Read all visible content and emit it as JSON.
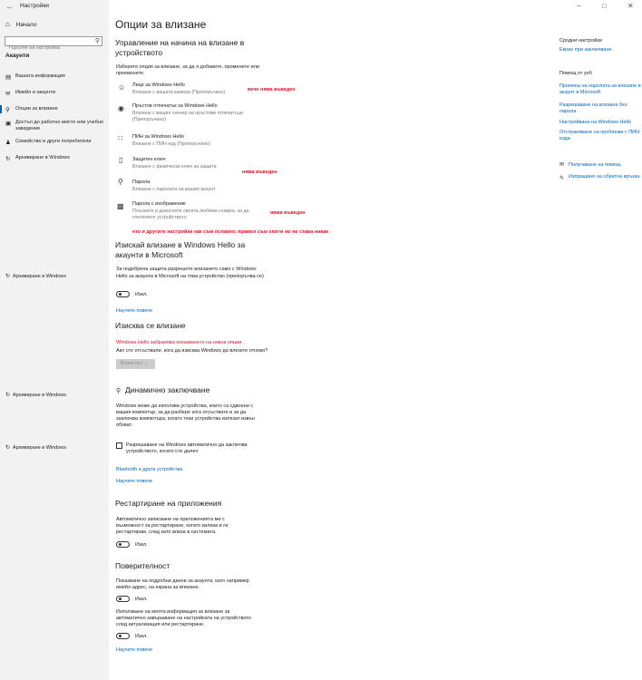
{
  "window": {
    "title": "Настройки",
    "back_icon": "back-arrow-icon",
    "minimize": "–",
    "maximize": "□",
    "close": "✕"
  },
  "sidebar": {
    "home": "Начало",
    "search_placeholder": "Търсене на настройка",
    "section": "Акаунти",
    "items": [
      {
        "label": "Вашата информация",
        "icon": "person-card-icon"
      },
      {
        "label": "Имейл и акаунти",
        "icon": "mail-icon"
      },
      {
        "label": "Опции за влизане",
        "icon": "key-icon"
      },
      {
        "label": "Достъп до работно място или учебно заведение",
        "icon": "briefcase-icon"
      },
      {
        "label": "Семейство и други потребители",
        "icon": "people-icon"
      },
      {
        "label": "Архивиране в Windows",
        "icon": "sync-icon"
      }
    ],
    "archive_repeats": [
      "Архивиране в Windows",
      "Архивиране в Windows",
      "Архивиране в Windows"
    ]
  },
  "main": {
    "title": "Опции за влизане",
    "manage_heading": "Управление на начина на влизане в устройството",
    "choose_text": "Изберете опция за влизане, за да я добавите, промените или премахнете.",
    "options": [
      {
        "title": "Лице за Windows Hello",
        "desc": "Влизане с вашата камера (Препоръчано)",
        "icon": "face-icon",
        "note": "вече няма въведен"
      },
      {
        "title": "Пръстов отпечатък за Windows Hello",
        "desc": "Влизане с вашия скенер на пръстови отпечатъци (Препоръчано)",
        "icon": "fingerprint-icon",
        "note": ""
      },
      {
        "title": "ПИН за Windows Hello",
        "desc": "Влизане с ПИН код (Препоръчано)",
        "icon": "pin-keypad-icon",
        "note": ""
      },
      {
        "title": "Защитен ключ",
        "desc": "Влизане с физически ключ за защита",
        "icon": "usb-key-icon",
        "note": "няма въведен"
      },
      {
        "title": "Парола",
        "desc": "Влизане с паролата на вашия акаунт",
        "icon": "password-key-icon",
        "note": ""
      },
      {
        "title": "Парола с изображение",
        "desc": "Плъзнете и докоснете своята любима снимка, за да отключите устройството",
        "icon": "picture-icon",
        "note": "няма въведен"
      }
    ],
    "red_comment": "ето и другите настройки как съм оставил, правил съм опити но не става никак",
    "hello_heading": "Изискай влизане в Windows Hello за акаунти в Microsoft",
    "hello_desc": "За подобрена защита разрешете влизането само с Windows Hello за акаунти в Microsoft на това устройство (препоръчва се)",
    "toggle_off": "Изкл.",
    "learn_more": "Научете повече",
    "require_heading": "Изисква се влизане",
    "hello_blocked": "Windows Hello забранява показването на някои опции.",
    "away_question": "Ако сте отсъствали, кога да изисква Windows да влезете отново?",
    "never_button": "Всеки път",
    "dynamic_heading": "Динамично заключване",
    "dynamic_desc": "Windows може да използва устройства, които са сдвоени с вашия компютър, за да разбере кога отсъствате и за да заключва компютъра, когато тези устройства излязат извън обхват.",
    "dynamic_checkbox": "Разрешаване на Windows автоматично да заключва устройството, когато сте далеч",
    "bluetooth_link": "Bluetooth и други устройства",
    "restart_heading": "Рестартиране на приложения",
    "restart_desc": "Автоматично записване на приложенията ми с възможност за рестартиране, когато излиза и ги рестартирам, след като влиза в системата.",
    "privacy_heading": "Поверителност",
    "privacy_desc1": "Показване на подробни данни за акаунта, като например имейл адрес, на екрана за влизане.",
    "privacy_desc2": "Използване на моята информация за влизане за автоматично завършване на настройката на устройството след актуализация или рестартиране."
  },
  "right": {
    "related_heading": "Сродни настройки",
    "related_link": "Екран при заключване",
    "help_heading": "Помощ от уеб",
    "help_links": [
      "Промяна на паролата за влизане в акаунт в Microsoft",
      "Разрешаване на влизане без парола",
      "Настройване на Windows Hello",
      "Отстраняване на проблеми с ПИН кода"
    ],
    "get_help": "Получаване на помощ",
    "feedback": "Изпращане на обратна връзка"
  },
  "colors": {
    "accent": "#0067c0",
    "warning_red": "#e81123",
    "sidebar_bg": "#f2f2f2"
  }
}
